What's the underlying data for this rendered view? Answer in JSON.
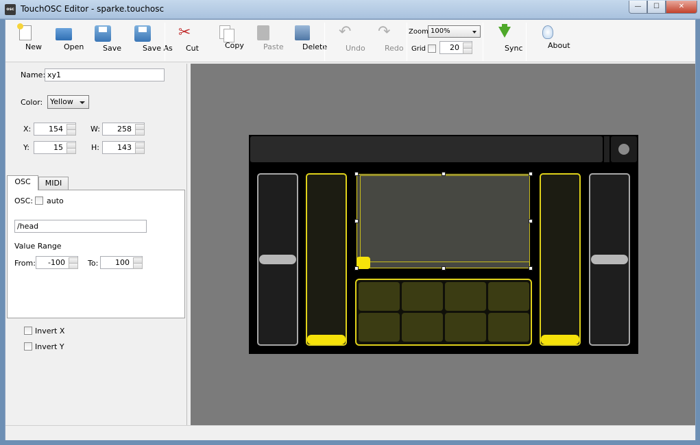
{
  "window": {
    "title": "TouchOSC Editor - sparke.touchosc",
    "app_icon_text": "osc",
    "min_glyph": "—",
    "max_glyph": "☐",
    "close_glyph": "✕"
  },
  "toolbar": {
    "new": "New",
    "open": "Open",
    "save": "Save",
    "save_as": "Save As",
    "cut": "Cut",
    "copy": "Copy",
    "paste": "Paste",
    "delete": "Delete",
    "undo": "Undo",
    "redo": "Redo",
    "zoom_label": "Zoom",
    "zoom_value": "100%",
    "grid_label": "Grid",
    "grid_value": "20",
    "sync": "Sync",
    "about": "About"
  },
  "properties": {
    "name_label": "Name:",
    "name_value": "xy1",
    "color_label": "Color:",
    "color_value": "Yellow",
    "x_label": "X:",
    "x_value": "154",
    "y_label": "Y:",
    "y_value": "15",
    "w_label": "W:",
    "w_value": "258",
    "h_label": "H:",
    "h_value": "143"
  },
  "tabs": {
    "osc": "OSC",
    "midi": "MIDI"
  },
  "osc": {
    "osc_label": "OSC:",
    "auto_label": "auto",
    "address": "/head",
    "value_range_label": "Value Range",
    "from_label": "From:",
    "from_value": "-100",
    "to_label": "To:",
    "to_value": "100"
  },
  "invert": {
    "invert_x": "Invert X",
    "invert_y": "Invert Y"
  },
  "canvas": {
    "left_fader_level": 0.5,
    "right_fader_level": 0.5,
    "xy_cursor": [
      0,
      0
    ],
    "accent_color": "#f6e20a"
  }
}
